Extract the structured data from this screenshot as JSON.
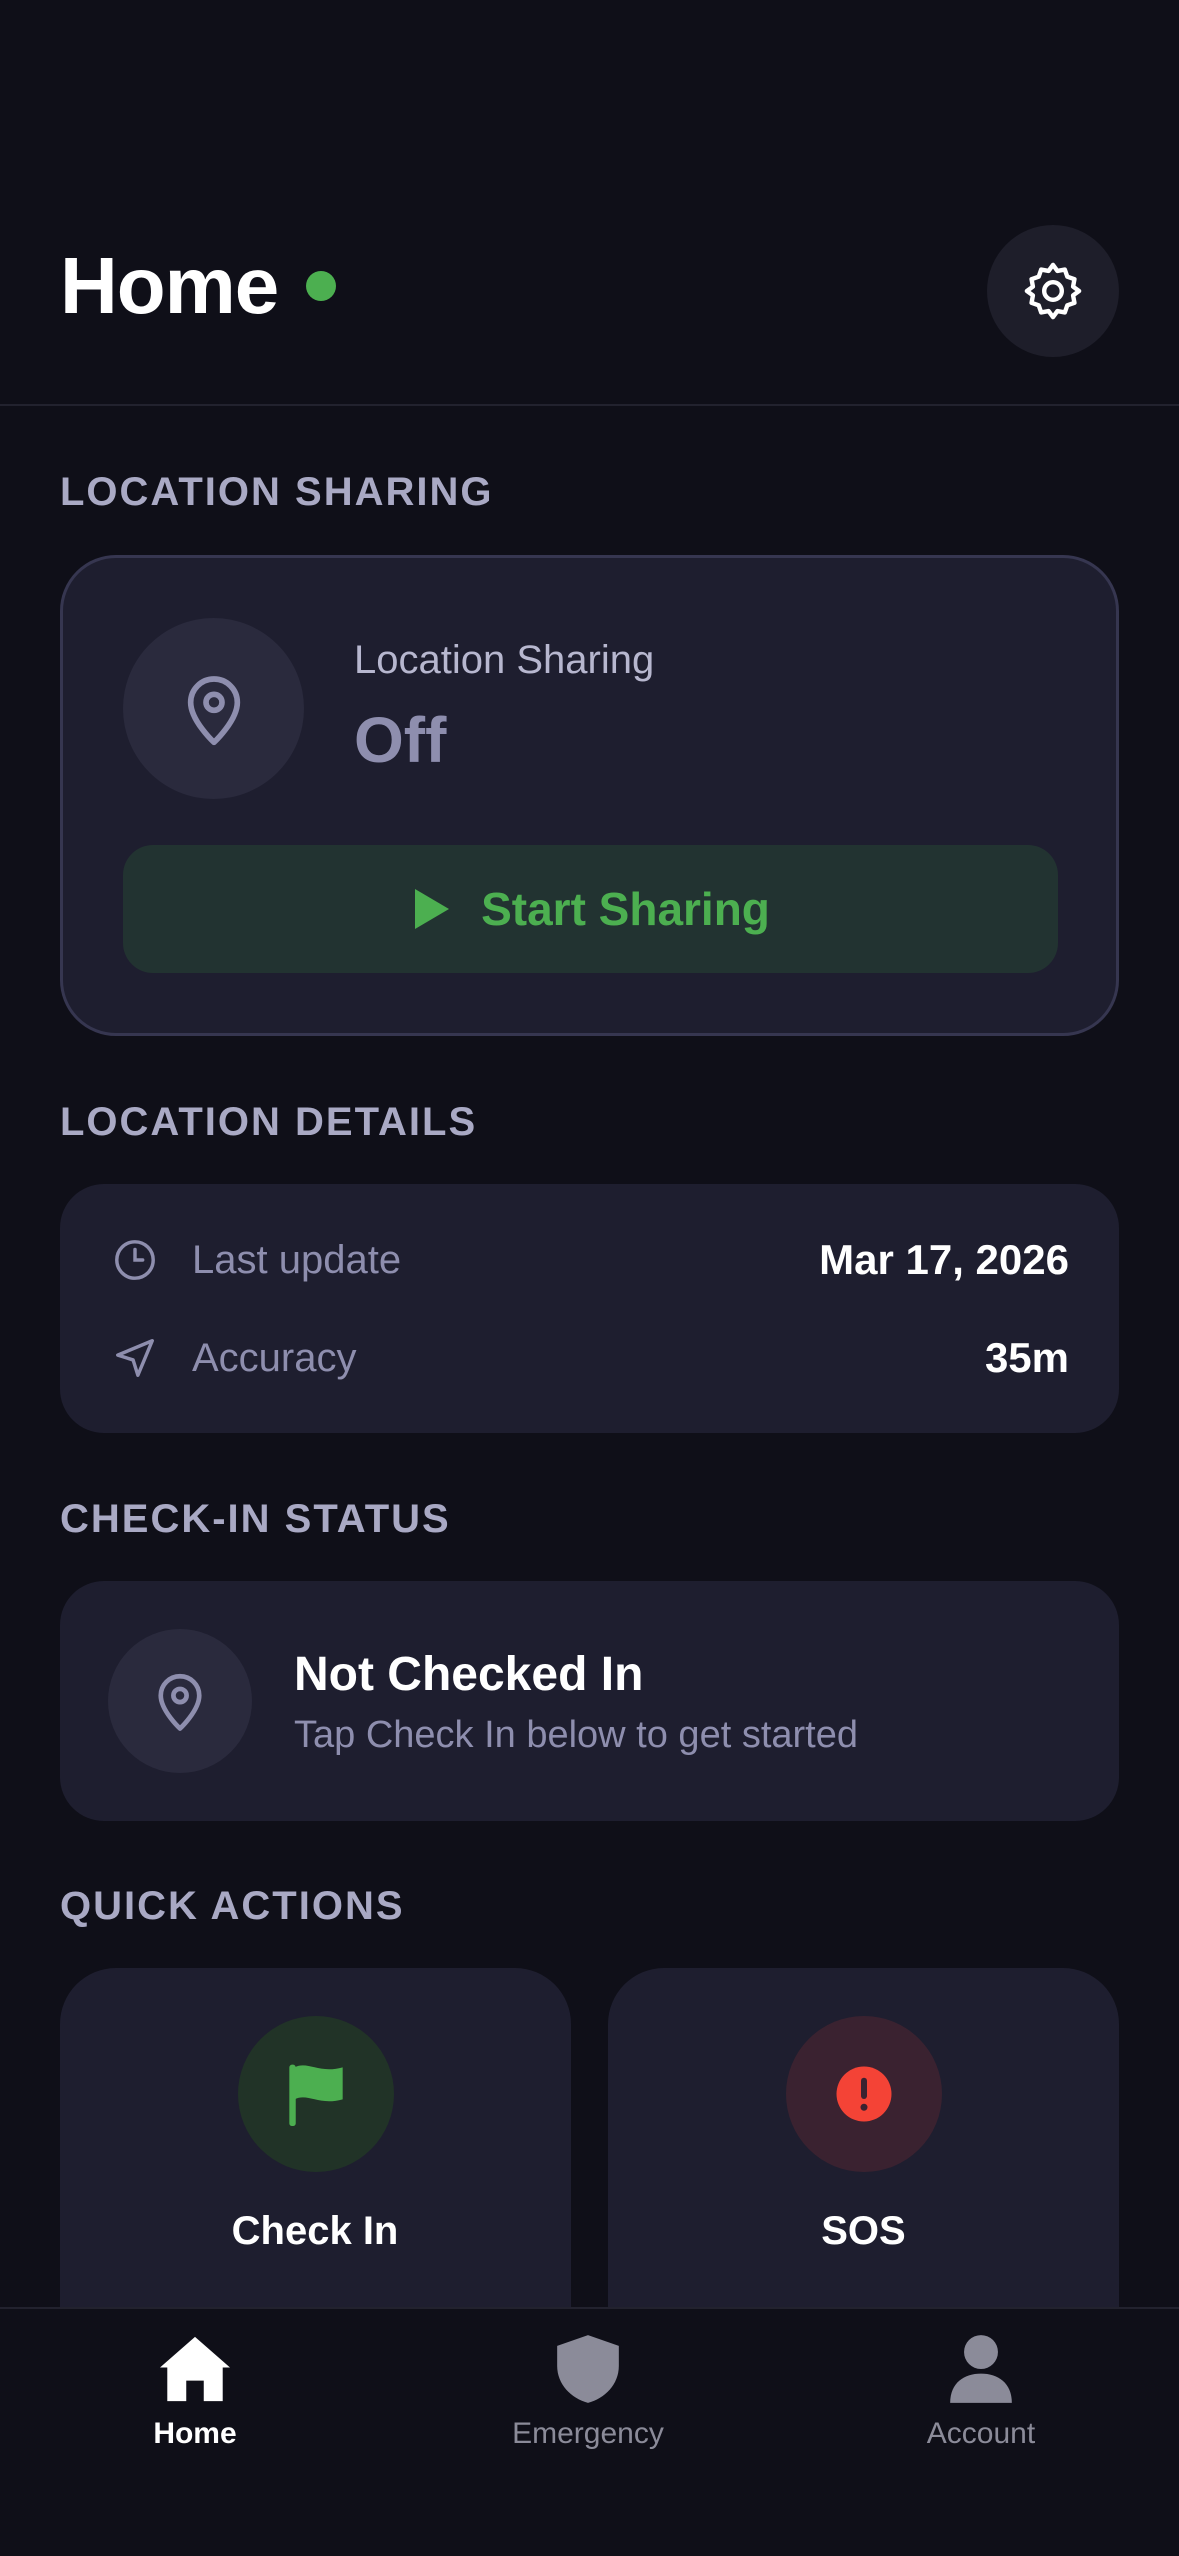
{
  "header": {
    "title": "Home",
    "status_color": "#4caf50",
    "settings_icon": "gear-icon"
  },
  "sections": {
    "location_sharing": "LOCATION SHARING",
    "location_details": "LOCATION DETAILS",
    "checkin_status": "CHECK-IN STATUS",
    "quick_actions": "QUICK ACTIONS"
  },
  "sharing": {
    "label": "Location Sharing",
    "state": "Off",
    "button_label": "Start Sharing",
    "button_icon": "play-icon",
    "accent": "#4caf50"
  },
  "details": {
    "rows": [
      {
        "icon": "clock-icon",
        "label": "Last update",
        "value": "Mar 17, 2026"
      },
      {
        "icon": "navigation-arrow-icon",
        "label": "Accuracy",
        "value": "35m"
      }
    ]
  },
  "checkin": {
    "title": "Not Checked In",
    "subtitle": "Tap Check In below to get started"
  },
  "actions": {
    "checkin": {
      "label": "Check In",
      "icon": "flag-icon",
      "color": "#4caf50"
    },
    "sos": {
      "label": "SOS",
      "icon": "alert-icon",
      "color": "#f44336"
    }
  },
  "tabs": [
    {
      "label": "Home",
      "icon": "home-icon",
      "active": true
    },
    {
      "label": "Emergency",
      "icon": "shield-icon",
      "active": false
    },
    {
      "label": "Account",
      "icon": "person-icon",
      "active": false
    }
  ]
}
